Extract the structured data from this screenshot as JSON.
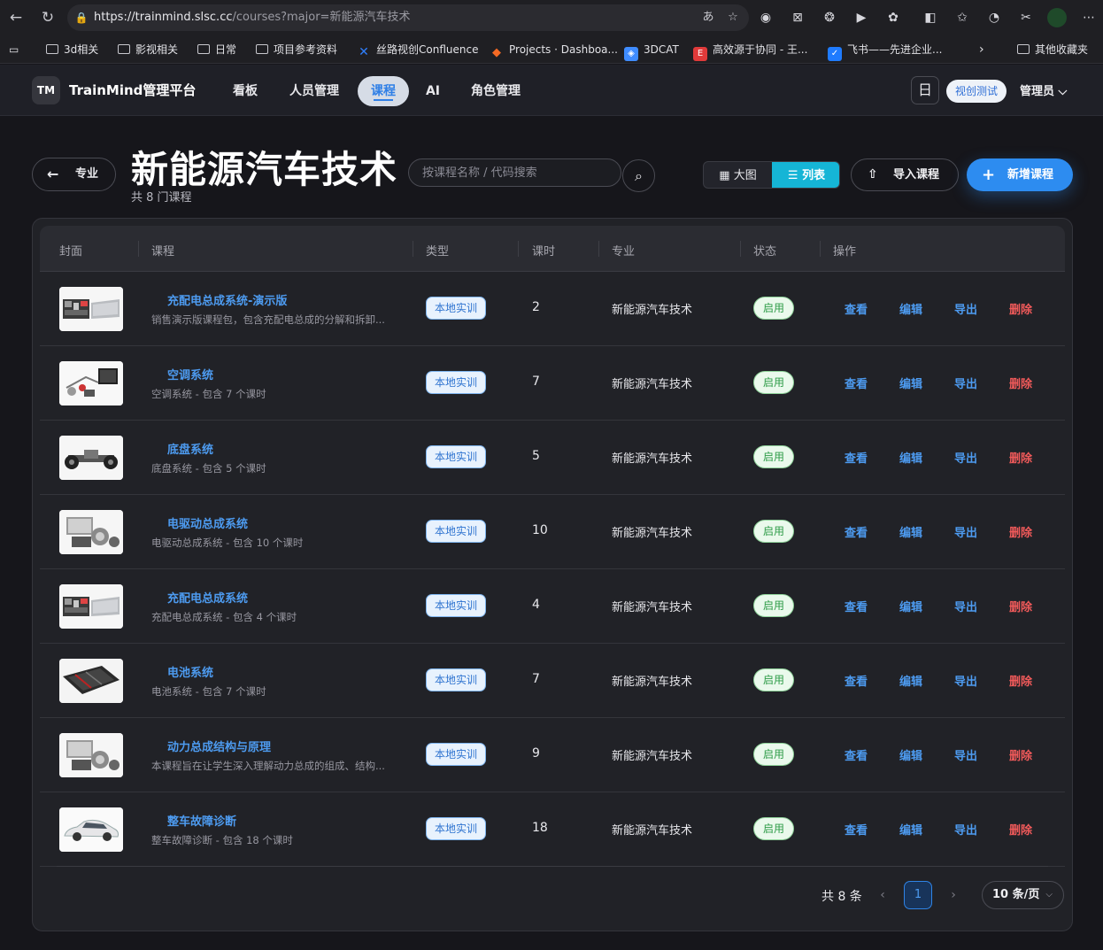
{
  "browser": {
    "url_host": "https://trainmind.slsc.cc",
    "url_path": "/courses?major=新能源汽车技术",
    "bookmarks": [
      {
        "label": "3d相关",
        "icon": "folder-icon"
      },
      {
        "label": "影视相关",
        "icon": "folder-icon"
      },
      {
        "label": "日常",
        "icon": "folder-icon"
      },
      {
        "label": "项目参考资料",
        "icon": "folder-icon"
      },
      {
        "label": "丝路视创Confluence",
        "icon": "confluence-icon"
      },
      {
        "label": "Projects · Dashboa...",
        "icon": "gitlab-icon"
      },
      {
        "label": "3DCAT",
        "icon": "3dcat-icon"
      },
      {
        "label": "高效源于协同 - 王...",
        "icon": "red-e-icon"
      },
      {
        "label": "飞书——先进企业...",
        "icon": "feishu-icon"
      }
    ],
    "other_bookmarks": "其他收藏夹"
  },
  "app": {
    "logo": "TM",
    "name": "TrainMind管理平台",
    "nav": [
      {
        "label": "看板",
        "active": false
      },
      {
        "label": "人员管理",
        "active": false
      },
      {
        "label": "课程",
        "active": true
      },
      {
        "label": "AI",
        "active": false
      },
      {
        "label": "角色管理",
        "active": false
      }
    ],
    "calendar_glyph": "日",
    "env_badge": "视创测试",
    "user": "管理员"
  },
  "page": {
    "back_label": "专业",
    "title": "新能源汽车技术",
    "subtitle": "共 8 门课程",
    "search_placeholder": "按课程名称 / 代码搜索",
    "view_big": "大图",
    "view_list": "列表",
    "import_label": "导入课程",
    "add_label": "新增课程"
  },
  "table": {
    "columns": [
      "封面",
      "课程",
      "类型",
      "课时",
      "专业",
      "状态",
      "操作"
    ],
    "actions": {
      "view": "查看",
      "edit": "编辑",
      "export": "导出",
      "delete": "删除"
    },
    "rows": [
      {
        "name": "充配电总成系统-演示版",
        "desc": "销售演示版课程包，包含充配电总成的分解和拆卸...",
        "type": "本地实训",
        "hours": "2",
        "major": "新能源汽车技术",
        "status": "启用",
        "thumb": "charger"
      },
      {
        "name": "空调系统",
        "desc": "空调系统 - 包含 7 个课时",
        "type": "本地实训",
        "hours": "7",
        "major": "新能源汽车技术",
        "status": "启用",
        "thumb": "ac"
      },
      {
        "name": "底盘系统",
        "desc": "底盘系统 - 包含 5 个课时",
        "type": "本地实训",
        "hours": "5",
        "major": "新能源汽车技术",
        "status": "启用",
        "thumb": "chassis"
      },
      {
        "name": "电驱动总成系统",
        "desc": "电驱动总成系统 - 包含 10 个课时",
        "type": "本地实训",
        "hours": "10",
        "major": "新能源汽车技术",
        "status": "启用",
        "thumb": "drive"
      },
      {
        "name": "充配电总成系统",
        "desc": "充配电总成系统 - 包含 4 个课时",
        "type": "本地实训",
        "hours": "4",
        "major": "新能源汽车技术",
        "status": "启用",
        "thumb": "charger"
      },
      {
        "name": "电池系统",
        "desc": "电池系统 - 包含 7 个课时",
        "type": "本地实训",
        "hours": "7",
        "major": "新能源汽车技术",
        "status": "启用",
        "thumb": "battery"
      },
      {
        "name": "动力总成结构与原理",
        "desc": "本课程旨在让学生深入理解动力总成的组成、结构...",
        "type": "本地实训",
        "hours": "9",
        "major": "新能源汽车技术",
        "status": "启用",
        "thumb": "drive"
      },
      {
        "name": "整车故障诊断",
        "desc": "整车故障诊断 - 包含 18 个课时",
        "type": "本地实训",
        "hours": "18",
        "major": "新能源汽车技术",
        "status": "启用",
        "thumb": "car"
      }
    ]
  },
  "pagination": {
    "total": "共 8 条",
    "current": "1",
    "page_size": "10 条/页"
  }
}
